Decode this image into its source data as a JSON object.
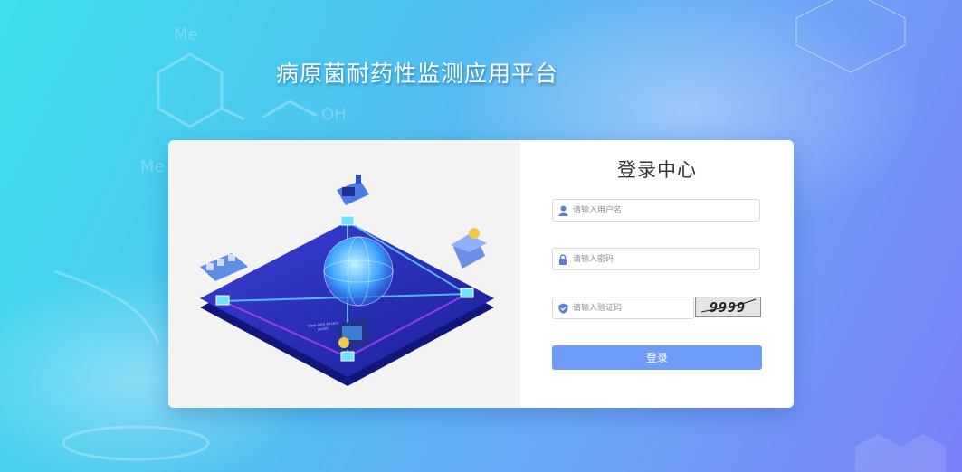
{
  "app": {
    "title": "病原菌耐药性监测应用平台"
  },
  "illustration": {
    "caption": "View with bitcoin wallet"
  },
  "login": {
    "title": "登录中心",
    "username_placeholder": "请输入用户名",
    "password_placeholder": "请输入密码",
    "captcha_placeholder": "请输入验证码",
    "captcha_text": "9999",
    "submit_label": "登录"
  },
  "colors": {
    "button": "#6f9bf9",
    "card": "#ffffff",
    "illustration_bg": "#f3f3f4"
  },
  "icons": {
    "username": "user-icon",
    "password": "lock-icon",
    "captcha": "shield-icon"
  }
}
